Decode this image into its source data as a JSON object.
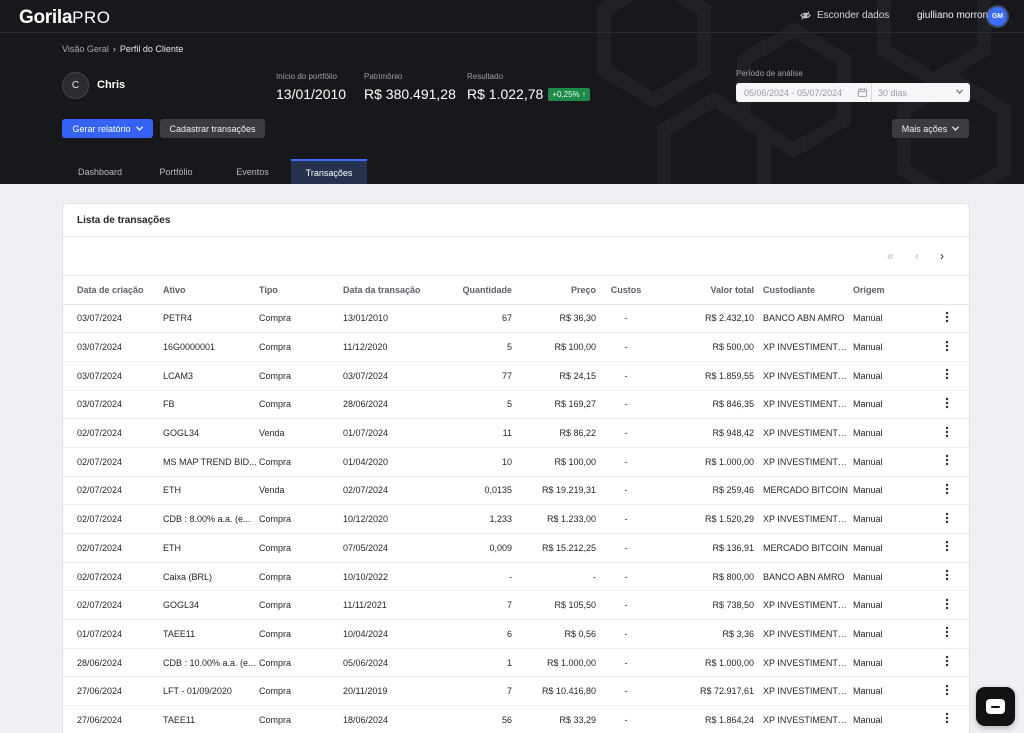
{
  "app": {
    "logo_main": "Gorila",
    "logo_sub": "PRO"
  },
  "topbar": {
    "hide_data_label": "Esconder dados",
    "user_name": "giulliano morroni",
    "user_initials": "GM"
  },
  "breadcrumb": {
    "root": "Visão Geral",
    "separator": "›",
    "current": "Perfil do Cliente"
  },
  "client": {
    "initial": "C",
    "name": "Chris"
  },
  "stats": {
    "start": {
      "label": "Início do portfólio",
      "value": "13/01/2010"
    },
    "equity": {
      "label": "Patrimônio",
      "value": "R$ 380.491,28"
    },
    "result": {
      "label": "Resultado",
      "value": "R$ 1.022,78",
      "badge": "+0,25% ↑"
    }
  },
  "period": {
    "label": "Período de análise",
    "dates": "05/06/2024 - 05/07/2024",
    "range": "30 dias"
  },
  "buttons": {
    "report": "Gerar relatório",
    "register": "Cadastrar transações",
    "more": "Mais ações"
  },
  "tabs": [
    "Dashboard",
    "Portfólio",
    "Eventos",
    "Transações"
  ],
  "card": {
    "title": "Lista de transações"
  },
  "pager": {
    "first": "«",
    "prev": "‹",
    "next": "›"
  },
  "table": {
    "headers": [
      "Data de criação",
      "Ativo",
      "Tipo",
      "Data da transação",
      "Quantidade",
      "Preço",
      "Custos",
      "Valor total",
      "Custodiante",
      "Origem"
    ],
    "rows": [
      [
        "03/07/2024",
        "PETR4",
        "Compra",
        "13/01/2010",
        "67",
        "R$ 36,30",
        "-",
        "R$ 2.432,10",
        "BANCO ABN AMRO",
        "Manual"
      ],
      [
        "03/07/2024",
        "16G0000001",
        "Compra",
        "11/12/2020",
        "5",
        "R$ 100,00",
        "-",
        "R$ 500,00",
        "XP INVESTIMENTOS ...",
        "Manual"
      ],
      [
        "03/07/2024",
        "LCAM3",
        "Compra",
        "03/07/2024",
        "77",
        "R$ 24,15",
        "-",
        "R$ 1.859,55",
        "XP INVESTIMENTOS ...",
        "Manual"
      ],
      [
        "03/07/2024",
        "FB",
        "Compra",
        "28/06/2024",
        "5",
        "R$ 169,27",
        "-",
        "R$ 846,35",
        "XP INVESTIMENTOS ...",
        "Manual"
      ],
      [
        "02/07/2024",
        "GOGL34",
        "Venda",
        "01/07/2024",
        "11",
        "R$ 86,22",
        "-",
        "R$ 948,42",
        "XP INVESTIMENTOS ...",
        "Manual"
      ],
      [
        "02/07/2024",
        "MS MAP TREND BID...",
        "Compra",
        "01/04/2020",
        "10",
        "R$ 100,00",
        "-",
        "R$ 1.000,00",
        "XP INVESTIMENTOS ...",
        "Manual"
      ],
      [
        "02/07/2024",
        "ETH",
        "Venda",
        "02/07/2024",
        "0,0135",
        "R$ 19.219,31",
        "-",
        "R$ 259,46",
        "MERCADO BITCOIN",
        "Manual"
      ],
      [
        "02/07/2024",
        "CDB : 8.00% a.a. (e...",
        "Compra",
        "10/12/2020",
        "1,233",
        "R$ 1.233,00",
        "-",
        "R$ 1.520,29",
        "XP INVESTIMENTOS ...",
        "Manual"
      ],
      [
        "02/07/2024",
        "ETH",
        "Compra",
        "07/05/2024",
        "0,009",
        "R$ 15.212,25",
        "-",
        "R$ 136,91",
        "MERCADO BITCOIN",
        "Manual"
      ],
      [
        "02/07/2024",
        "Caixa (BRL)",
        "Compra",
        "10/10/2022",
        "-",
        "-",
        "-",
        "R$ 800,00",
        "BANCO ABN AMRO",
        "Manual"
      ],
      [
        "02/07/2024",
        "GOGL34",
        "Compra",
        "11/11/2021",
        "7",
        "R$ 105,50",
        "-",
        "R$ 738,50",
        "XP INVESTIMENTOS ...",
        "Manual"
      ],
      [
        "01/07/2024",
        "TAEE11",
        "Compra",
        "10/04/2024",
        "6",
        "R$ 0,56",
        "-",
        "R$ 3,36",
        "XP INVESTIMENTOS ...",
        "Manual"
      ],
      [
        "28/06/2024",
        "CDB : 10.00% a.a. (e...",
        "Compra",
        "05/06/2024",
        "1",
        "R$ 1.000,00",
        "-",
        "R$ 1.000,00",
        "XP INVESTIMENTOS ...",
        "Manual"
      ],
      [
        "27/06/2024",
        "LFT - 01/09/2020",
        "Compra",
        "20/11/2019",
        "7",
        "R$ 10.416,80",
        "-",
        "R$ 72.917,61",
        "XP INVESTIMENTOS ...",
        "Manual"
      ],
      [
        "27/06/2024",
        "TAEE11",
        "Compra",
        "18/06/2024",
        "56",
        "R$ 33,29",
        "-",
        "R$ 1.864,24",
        "XP INVESTIMENTOS ...",
        "Manual"
      ]
    ]
  },
  "colors": {
    "accent": "#3463f5",
    "positive": "#1e8a48",
    "header_bg": "#17181c"
  }
}
